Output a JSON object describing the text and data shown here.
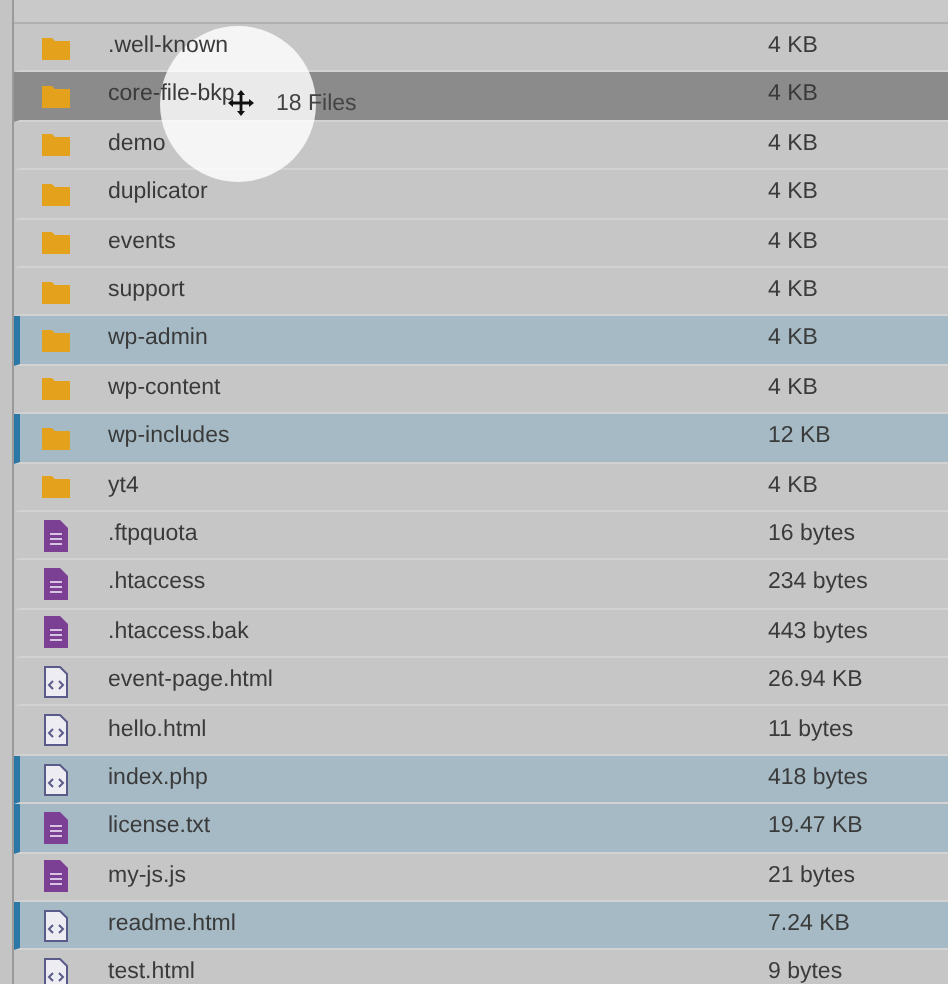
{
  "files": [
    {
      "name": ".well-known",
      "size": "4 KB",
      "kind": "folder",
      "selected": false,
      "dragging": false
    },
    {
      "name": "core-file-bkp",
      "size": "4 KB",
      "kind": "folder",
      "selected": false,
      "dragging": true
    },
    {
      "name": "demo",
      "size": "4 KB",
      "kind": "folder",
      "selected": false,
      "dragging": false
    },
    {
      "name": "duplicator",
      "size": "4 KB",
      "kind": "folder",
      "selected": false,
      "dragging": false
    },
    {
      "name": "events",
      "size": "4 KB",
      "kind": "folder",
      "selected": false,
      "dragging": false
    },
    {
      "name": "support",
      "size": "4 KB",
      "kind": "folder",
      "selected": false,
      "dragging": false
    },
    {
      "name": "wp-admin",
      "size": "4 KB",
      "kind": "folder",
      "selected": true,
      "dragging": false
    },
    {
      "name": "wp-content",
      "size": "4 KB",
      "kind": "folder",
      "selected": false,
      "dragging": false
    },
    {
      "name": "wp-includes",
      "size": "12 KB",
      "kind": "folder",
      "selected": true,
      "dragging": false
    },
    {
      "name": "yt4",
      "size": "4 KB",
      "kind": "folder",
      "selected": false,
      "dragging": false
    },
    {
      "name": ".ftpquota",
      "size": "16 bytes",
      "kind": "text",
      "selected": false,
      "dragging": false
    },
    {
      "name": ".htaccess",
      "size": "234 bytes",
      "kind": "text",
      "selected": false,
      "dragging": false
    },
    {
      "name": ".htaccess.bak",
      "size": "443 bytes",
      "kind": "text",
      "selected": false,
      "dragging": false
    },
    {
      "name": "event-page.html",
      "size": "26.94 KB",
      "kind": "code",
      "selected": false,
      "dragging": false
    },
    {
      "name": "hello.html",
      "size": "11 bytes",
      "kind": "code",
      "selected": false,
      "dragging": false
    },
    {
      "name": "index.php",
      "size": "418 bytes",
      "kind": "code",
      "selected": true,
      "dragging": false
    },
    {
      "name": "license.txt",
      "size": "19.47 KB",
      "kind": "text",
      "selected": true,
      "dragging": false
    },
    {
      "name": "my-js.js",
      "size": "21 bytes",
      "kind": "text",
      "selected": false,
      "dragging": false
    },
    {
      "name": "readme.html",
      "size": "7.24 KB",
      "kind": "code",
      "selected": true,
      "dragging": false
    },
    {
      "name": "test.html",
      "size": "9 bytes",
      "kind": "code",
      "selected": false,
      "dragging": false
    }
  ],
  "drag_label": "18 Files"
}
